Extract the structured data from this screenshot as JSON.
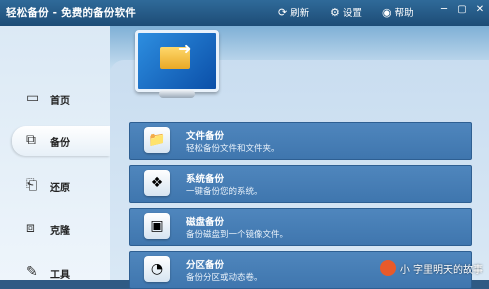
{
  "title": "轻松备份 - 免费的备份软件",
  "toolbar": {
    "refresh": "刷新",
    "settings": "设置",
    "help": "帮助"
  },
  "sidebar": {
    "items": [
      {
        "label": "首页",
        "icon": "monitor-icon"
      },
      {
        "label": "备份",
        "icon": "backup-icon"
      },
      {
        "label": "还原",
        "icon": "restore-icon"
      },
      {
        "label": "克隆",
        "icon": "clone-icon"
      },
      {
        "label": "工具",
        "icon": "tools-icon"
      }
    ]
  },
  "main": {
    "options": [
      {
        "title": "文件备份",
        "desc": "轻松备份文件和文件夹。",
        "icon": "folder-icon"
      },
      {
        "title": "系统备份",
        "desc": "一键备份您的系统。",
        "icon": "windows-icon"
      },
      {
        "title": "磁盘备份",
        "desc": "备份磁盘到一个镜像文件。",
        "icon": "disk-icon"
      },
      {
        "title": "分区备份",
        "desc": "备份分区或动态卷。",
        "icon": "partition-icon"
      }
    ]
  },
  "watermark": "小 字里明天的故事"
}
